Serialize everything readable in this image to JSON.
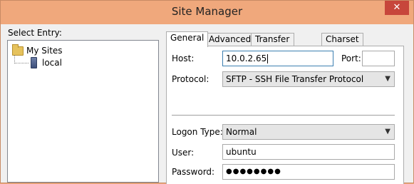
{
  "window": {
    "title": "Site Manager",
    "close_glyph": "✕"
  },
  "left": {
    "select_label": "Select Entry:",
    "tree": [
      {
        "label": "My Sites",
        "icon": "folder-icon"
      },
      {
        "label": "local",
        "icon": "server-icon"
      }
    ]
  },
  "tabs": [
    "General",
    "Advanced",
    "Transfer Settings",
    "Charset"
  ],
  "general": {
    "host_label": "Host:",
    "host_value": "10.0.2.65",
    "port_label": "Port:",
    "port_value": "",
    "protocol_label": "Protocol:",
    "protocol_value": "SFTP - SSH File Transfer Protocol",
    "logon_label": "Logon Type:",
    "logon_value": "Normal",
    "user_label": "User:",
    "user_value": "ubuntu",
    "password_label": "Password:",
    "password_value": "●●●●●●●●"
  }
}
